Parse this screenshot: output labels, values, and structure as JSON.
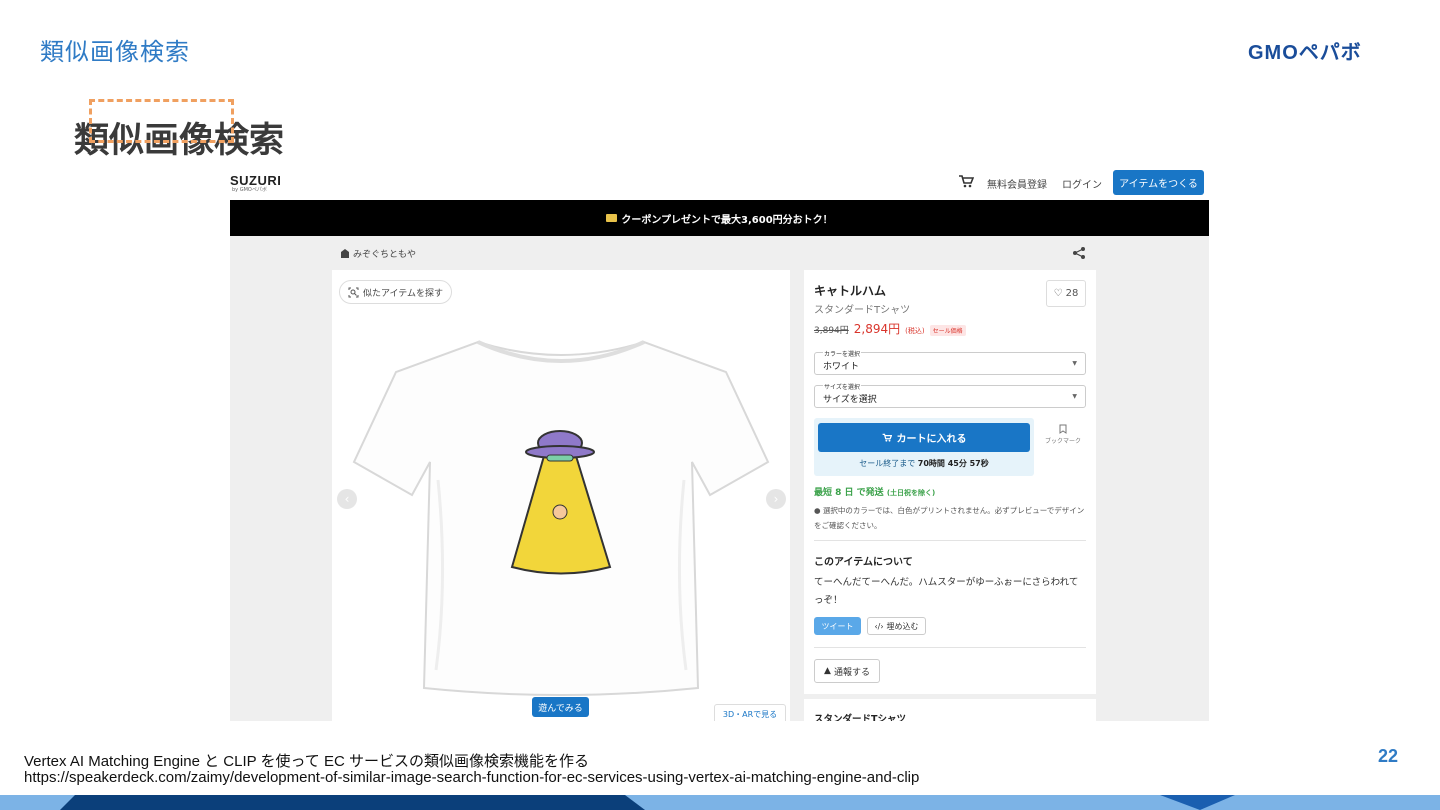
{
  "slide": {
    "header": "類似画像検索",
    "brand": "GMOペパボ",
    "title": "類似画像検索",
    "caption_title": "Vertex AI Matching Engine と CLIP を使って EC サービスの類似画像検索機能を作る",
    "caption_url": "https://speakerdeck.com/zaimy/development-of-similar-image-search-function-for-ec-services-using-vertex-ai-matching-engine-and-clip",
    "page_number": "22",
    "colors": {
      "accent": "#2f7bc5",
      "brand": "#1a4d9a",
      "footer_dark": "#0b3f7a",
      "footer_light": "#7cb3e6"
    }
  },
  "site": {
    "logo": "SUZURI",
    "logo_sub": "by GMOペパボ",
    "nav": {
      "cart_icon": "cart-icon",
      "signup": "無料会員登録",
      "login": "ログイン",
      "create": "アイテムをつくる"
    },
    "promo": "クーポンプレゼントで最大3,600円分おトク！",
    "shop_name": "みぞぐちともや",
    "colors": {
      "primary": "#1976c6",
      "sale": "#d9342b",
      "ship": "#3aa149"
    }
  },
  "product": {
    "find_similar": "似たアイテムを探す",
    "play_button": "遊んでみる",
    "ar_button": "3D・ARで見る",
    "title": "キャトルハム",
    "type": "スタンダードTシャツ",
    "favorites": "28",
    "price_old": "3,894円",
    "price_new": "2,894円",
    "price_tax": "(税込)",
    "sale_badge": "セール価格",
    "color_select": {
      "label": "カラーを選択",
      "value": "ホワイト"
    },
    "size_select": {
      "label": "サイズを選択",
      "value": "サイズを選択"
    },
    "add_to_cart": "カートに入れる",
    "sale_ends_prefix": "セール終了まで",
    "sale_ends_time": "70時間 45分 57秒",
    "bookmark": "ブックマーク",
    "shipping": "最短 8 日 で発送",
    "shipping_note": "(土日祝を除く)",
    "color_note": "選択中のカラーでは、白色がプリントされません。必ずプレビューでデザインをご確認ください。",
    "about_heading": "このアイテムについて",
    "about_text": "てーへんだてーへんだ。ハムスターがゆーふぉーにさらわれてっぞ！",
    "tweet": "ツイート",
    "embed": "埋め込む",
    "report": "通報する",
    "next_heading": "スタンダードTシャツ"
  }
}
